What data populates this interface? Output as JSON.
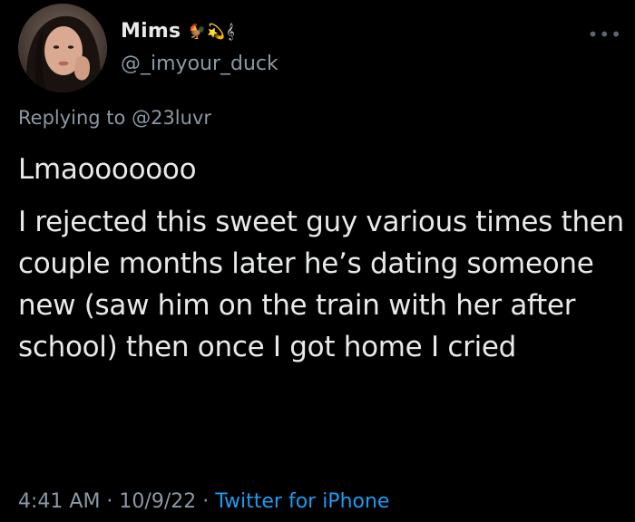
{
  "user": {
    "display_name": "Mims",
    "name_emoji": "🐓💫𝄞",
    "handle": "@_imyour_duck"
  },
  "more_icon": "•••",
  "reply": {
    "prefix": "Replying to ",
    "mention": "@23luvr"
  },
  "tweet": {
    "line1": "Lmaooooooo",
    "body": "I rejected this sweet guy various times then couple months later he’s dating someone new (saw him on the train with her after school) then once I got home I cried"
  },
  "meta": {
    "time": "4:41 AM",
    "sep1": " · ",
    "date": "10/9/22",
    "sep2": " · ",
    "source": "Twitter for iPhone"
  },
  "colors": {
    "background": "#000000",
    "text": "#e7e9ea",
    "secondary": "#8b98a5",
    "link": "#1d9bf0"
  }
}
